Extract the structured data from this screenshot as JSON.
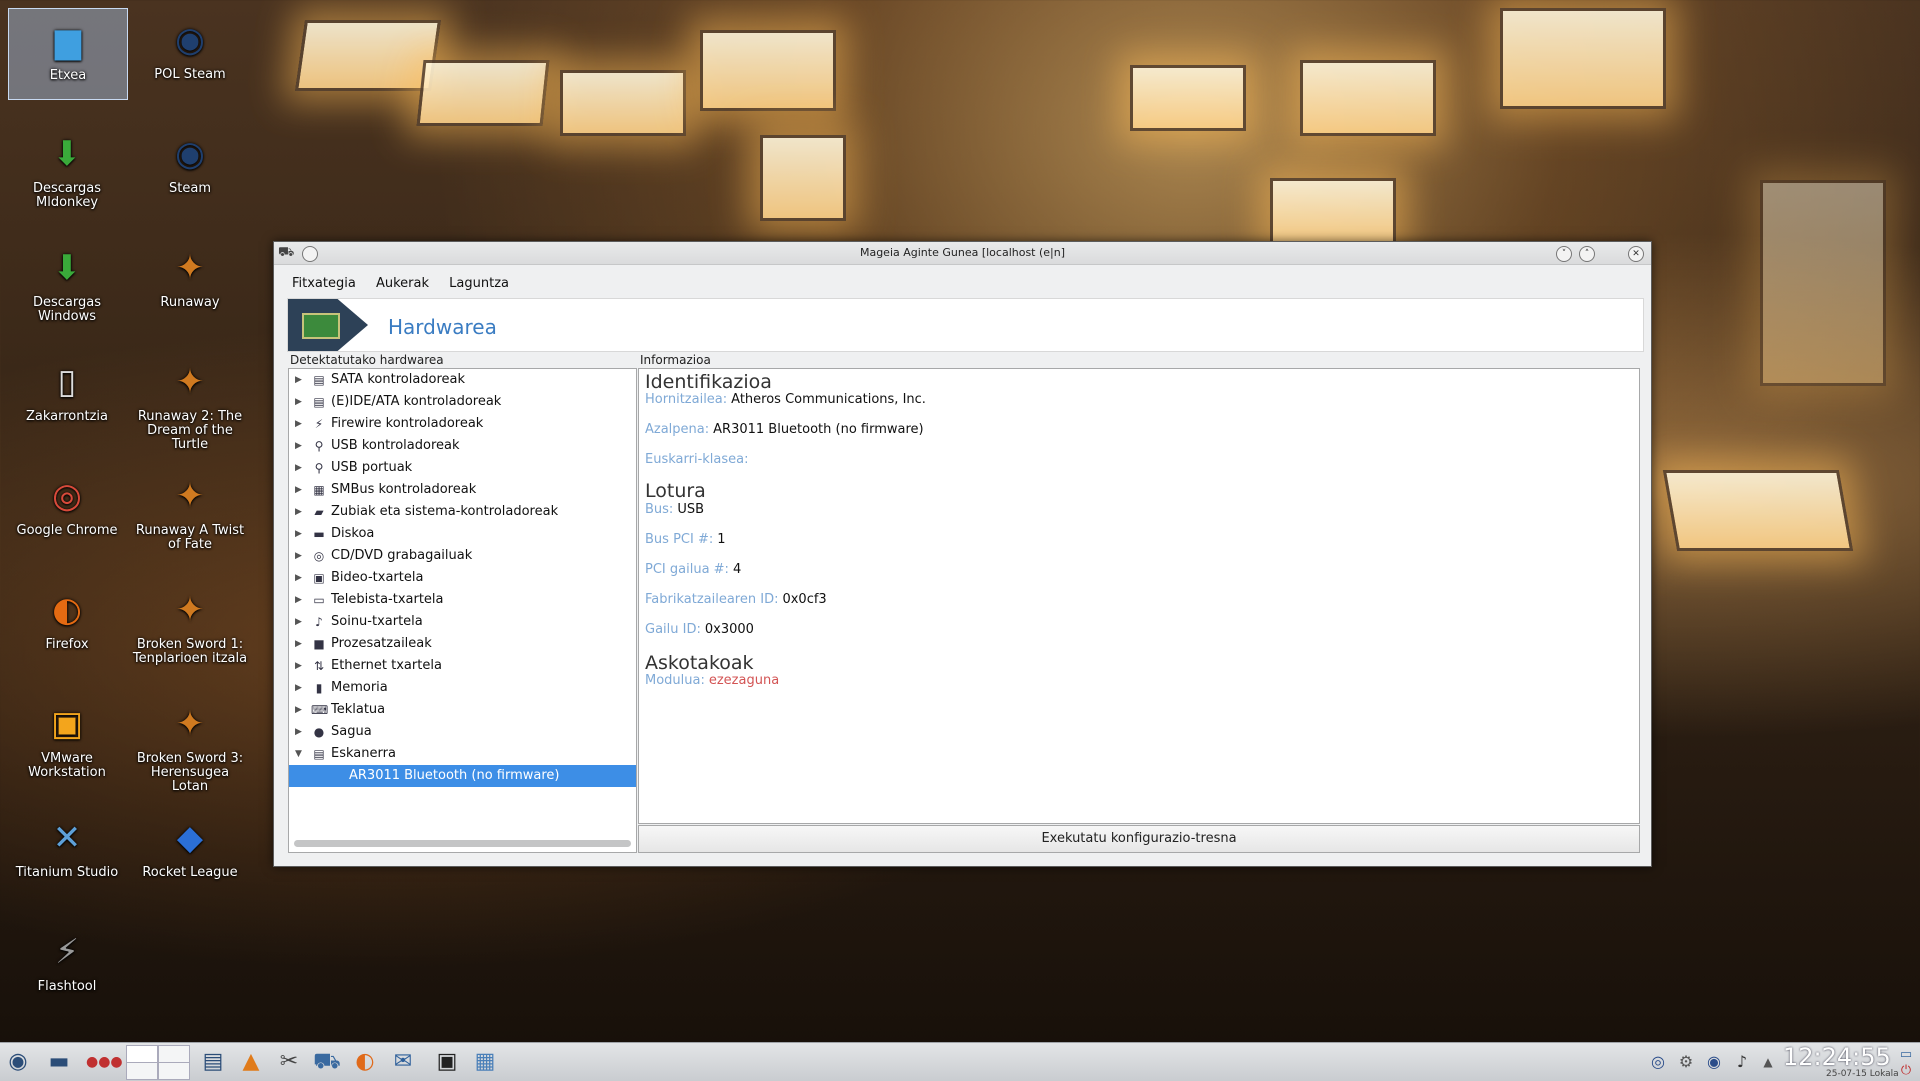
{
  "desktop": {
    "icons": [
      {
        "label": "Etxea",
        "glyph": "folder-icon"
      },
      {
        "label": "POL Steam",
        "glyph": "steam-icon"
      },
      {
        "label": "Descargas Mldonkey",
        "glyph": "download-folder-icon"
      },
      {
        "label": "Steam",
        "glyph": "steam-icon"
      },
      {
        "label": "Descargas Windows",
        "glyph": "download-folder-icon"
      },
      {
        "label": "Runaway",
        "glyph": "game-icon"
      },
      {
        "label": "Zakarrontzia",
        "glyph": "trash-icon"
      },
      {
        "label": "Runaway 2: The Dream of the Turtle",
        "glyph": "game-icon"
      },
      {
        "label": "Google Chrome",
        "glyph": "chrome-icon"
      },
      {
        "label": "Runaway A Twist of Fate",
        "glyph": "game-icon"
      },
      {
        "label": "Firefox",
        "glyph": "firefox-icon"
      },
      {
        "label": "Broken Sword 1: Tenplarioen itzala",
        "glyph": "game-icon"
      },
      {
        "label": "VMware Workstation",
        "glyph": "vmware-icon"
      },
      {
        "label": "Broken Sword 3: Herensugea Lotan",
        "glyph": "game-icon"
      },
      {
        "label": "Titanium Studio",
        "glyph": "titanium-icon"
      },
      {
        "label": "Rocket League",
        "glyph": "rocket-league-icon"
      },
      {
        "label": "Flashtool",
        "glyph": "flashtool-icon"
      }
    ]
  },
  "window": {
    "title": "Mageia Aginte Gunea  [localhost (e|n]",
    "menu": {
      "file": "Fitxategia",
      "options": "Aukerak",
      "help": "Laguntza"
    },
    "banner_title": "Hardwarea",
    "left_group_label": "Detektatutako hardwarea",
    "right_group_label": "Informazioa",
    "tree": [
      {
        "label": "SATA kontroladoreak",
        "icon": "disk-controller-icon"
      },
      {
        "label": "(E)IDE/ATA kontroladoreak",
        "icon": "disk-controller-icon"
      },
      {
        "label": "Firewire kontroladoreak",
        "icon": "firewire-icon"
      },
      {
        "label": "USB kontroladoreak",
        "icon": "usb-icon"
      },
      {
        "label": "USB portuak",
        "icon": "usb-icon"
      },
      {
        "label": "SMBus kontroladoreak",
        "icon": "chip-icon"
      },
      {
        "label": "Zubiak eta sistema-kontroladoreak",
        "icon": "bridge-icon"
      },
      {
        "label": "Diskoa",
        "icon": "harddisk-icon"
      },
      {
        "label": "CD/DVD grabagailuak",
        "icon": "cdrom-icon"
      },
      {
        "label": "Bideo-txartela",
        "icon": "videocard-icon"
      },
      {
        "label": "Telebista-txartela",
        "icon": "tvcard-icon"
      },
      {
        "label": "Soinu-txartela",
        "icon": "soundcard-icon"
      },
      {
        "label": "Prozesatzaileak",
        "icon": "cpu-icon"
      },
      {
        "label": "Ethernet txartela",
        "icon": "ethernet-icon"
      },
      {
        "label": "Memoria",
        "icon": "memory-icon"
      },
      {
        "label": "Teklatua",
        "icon": "keyboard-icon"
      },
      {
        "label": "Sagua",
        "icon": "mouse-icon"
      },
      {
        "label": "Eskanerra",
        "icon": "scanner-icon"
      }
    ],
    "selected_device": "AR3011 Bluetooth (no firmware)",
    "info": {
      "identification_title": "Identifikazioa",
      "vendor_key": "Hornitzailea:",
      "vendor_val": "Atheros Communications, Inc.",
      "description_key": "Azalpena:",
      "description_val": "AR3011 Bluetooth (no firmware)",
      "media_class_key": "Euskarri-klasea:",
      "connection_title": "Lotura",
      "bus_key": "Bus:",
      "bus_val": "USB",
      "bus_pci_key": "Bus PCI #:",
      "bus_pci_val": "1",
      "pci_device_key": "PCI gailua #:",
      "pci_device_val": "4",
      "vendor_id_key": "Fabrikatzailearen ID:",
      "vendor_id_val": "0x0cf3",
      "device_id_key": "Gailu ID:",
      "device_id_val": "0x3000",
      "misc_title": "Askotakoak",
      "module_key": "Modulua:",
      "module_val": "ezezaguna"
    },
    "run_button": "Exekutatu konfigurazio-tresna"
  },
  "taskbar": {
    "clock": "12:24:55",
    "date": "25-07-15 Lokala"
  }
}
